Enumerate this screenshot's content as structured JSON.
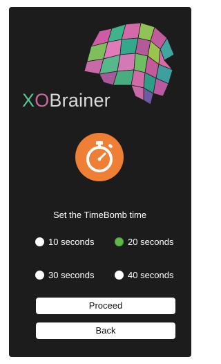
{
  "app": {
    "logo": {
      "x": "X",
      "o": "O",
      "rest": "Brainer"
    },
    "logo_icon": "brain-polygon-logo",
    "timer_icon": "stopwatch-icon"
  },
  "colors": {
    "background": "#1c1c1c",
    "accent_timer": "#ee7f35",
    "selected_radio": "#5fb84a",
    "logo_x": "#54c596",
    "logo_o": "#c96a9f"
  },
  "prompt": "Set the TimeBomb time",
  "options": [
    {
      "label": "10 seconds",
      "selected": false
    },
    {
      "label": "20 seconds",
      "selected": true
    },
    {
      "label": "30 seconds",
      "selected": false
    },
    {
      "label": "40 seconds",
      "selected": false
    }
  ],
  "buttons": {
    "proceed": "Proceed",
    "back": "Back"
  }
}
